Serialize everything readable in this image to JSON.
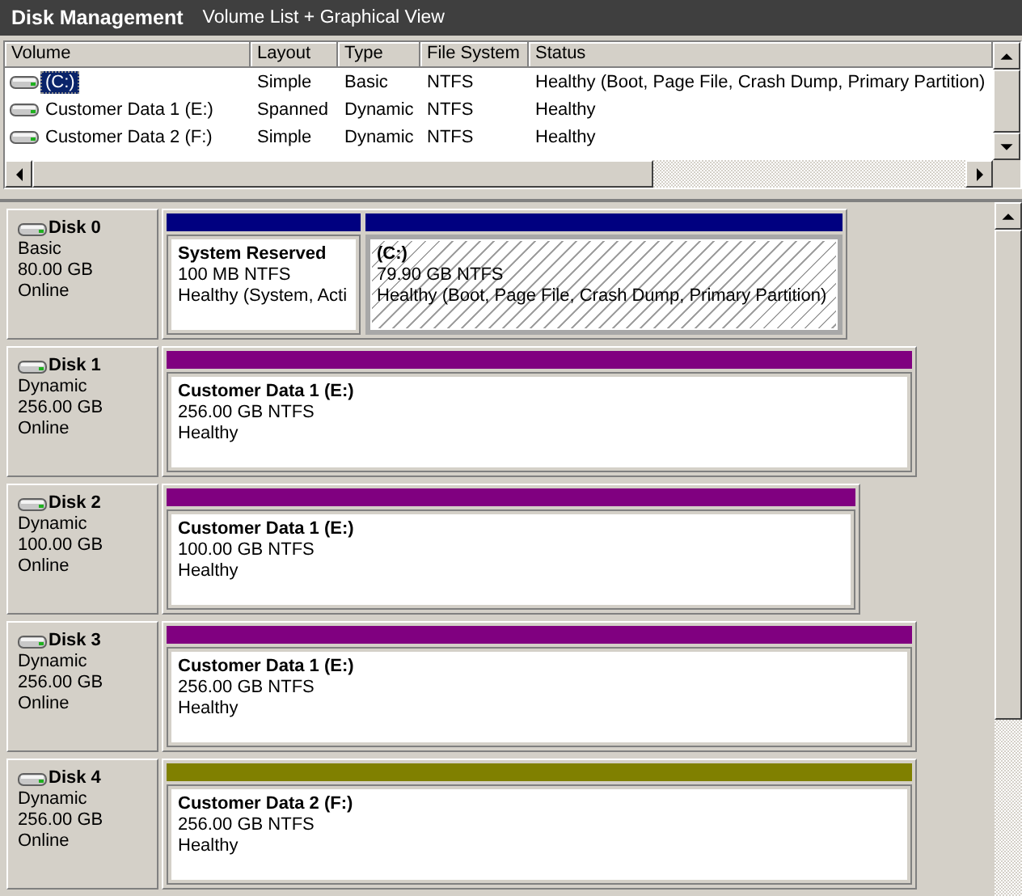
{
  "title_bar": {
    "title": "Disk Management",
    "view": "Volume List + Graphical View"
  },
  "volume_list": {
    "columns": [
      "Volume",
      "Layout",
      "Type",
      "File System",
      "Status"
    ],
    "rows": [
      {
        "cells": [
          "(C:)",
          "Simple",
          "Basic",
          "NTFS",
          "Healthy (Boot, Page File, Crash Dump, Primary Partition)"
        ],
        "selected": true
      },
      {
        "cells": [
          "Customer Data 1 (E:)",
          "Spanned",
          "Dynamic",
          "NTFS",
          "Healthy"
        ],
        "selected": false
      },
      {
        "cells": [
          "Customer Data 2 (F:)",
          "Simple",
          "Dynamic",
          "NTFS",
          "Healthy"
        ],
        "selected": false
      }
    ]
  },
  "disks": [
    {
      "name": "Disk 0",
      "type": "Basic",
      "size": "80.00 GB",
      "status": "Online",
      "partitions": [
        {
          "name": "System Reserved",
          "size": "100 MB NTFS",
          "status": "Healthy (System, Acti",
          "color": "#000080",
          "selected": false
        },
        {
          "name": "(C:)",
          "size": "79.90 GB NTFS",
          "status": "Healthy (Boot, Page File, Crash Dump, Primary Partition)",
          "color": "#000080",
          "selected": true
        }
      ]
    },
    {
      "name": "Disk 1",
      "type": "Dynamic",
      "size": "256.00 GB",
      "status": "Online",
      "partitions": [
        {
          "name": "Customer Data 1  (E:)",
          "size": "256.00 GB NTFS",
          "status": "Healthy",
          "color": "#800080",
          "selected": false
        }
      ]
    },
    {
      "name": "Disk 2",
      "type": "Dynamic",
      "size": "100.00 GB",
      "status": "Online",
      "partitions": [
        {
          "name": "Customer Data 1  (E:)",
          "size": "100.00 GB NTFS",
          "status": "Healthy",
          "color": "#800080",
          "selected": false
        }
      ]
    },
    {
      "name": "Disk 3",
      "type": "Dynamic",
      "size": "256.00 GB",
      "status": "Online",
      "partitions": [
        {
          "name": "Customer Data 1  (E:)",
          "size": "256.00 GB NTFS",
          "status": "Healthy",
          "color": "#800080",
          "selected": false
        }
      ]
    },
    {
      "name": "Disk 4",
      "type": "Dynamic",
      "size": "256.00 GB",
      "status": "Online",
      "partitions": [
        {
          "name": "Customer Data 2  (F:)",
          "size": "256.00 GB NTFS",
          "status": "Healthy",
          "color": "#808000",
          "selected": false
        }
      ]
    }
  ]
}
